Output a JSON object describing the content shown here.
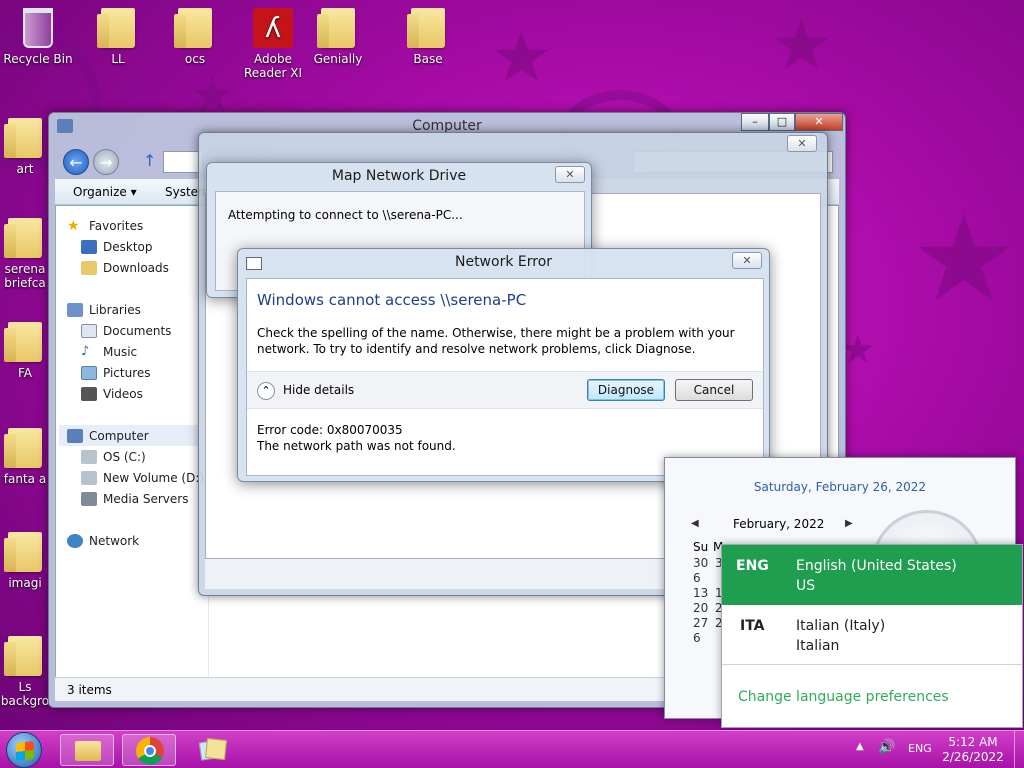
{
  "desktop_icons": [
    {
      "label": "Recycle Bin"
    },
    {
      "label": "LL"
    },
    {
      "label": "ocs"
    },
    {
      "label": "Adobe Reader XI"
    },
    {
      "label": "Genially"
    },
    {
      "label": "Base"
    },
    {
      "label": "art"
    },
    {
      "label": "serena briefca"
    },
    {
      "label": "FA"
    },
    {
      "label": "fanta a"
    },
    {
      "label": "imagi"
    },
    {
      "label": "Ls backgro"
    }
  ],
  "explorer": {
    "title": "Computer",
    "toolbar": {
      "organize": "Organize ▾",
      "system": "System"
    },
    "nav": {
      "favorites": "Favorites",
      "desktop": "Desktop",
      "downloads": "Downloads",
      "libraries": "Libraries",
      "documents": "Documents",
      "music": "Music",
      "pictures": "Pictures",
      "videos": "Videos",
      "computer": "Computer",
      "os_c": "OS (C:)",
      "new_volume": "New Volume (D:)",
      "media_servers": "Media Servers",
      "network": "Network"
    },
    "status": "3 items"
  },
  "map_drive": {
    "title": "Map Network Drive",
    "message": "Attempting to connect to \\\\serena-PC..."
  },
  "network_error": {
    "title": "Network Error",
    "heading": "Windows cannot access \\\\serena-PC",
    "body": "Check the spelling of the name. Otherwise, there might be a problem with your network. To try to identify and resolve network problems, click Diagnose.",
    "hide_details": "Hide details",
    "diagnose": "Diagnose",
    "cancel": "Cancel",
    "error_code": "Error code: 0x80070035",
    "error_detail": "The network path was not found."
  },
  "calendar": {
    "date_long": "Saturday, February 26, 2022",
    "month": "February, 2022",
    "weekday_headers": [
      "Su",
      "M"
    ],
    "col1": [
      "30",
      "6",
      "13",
      "20",
      "27",
      "6"
    ],
    "col2": [
      "3",
      "",
      "1",
      "2",
      "2",
      ""
    ]
  },
  "language_menu": {
    "items": [
      {
        "code": "ENG",
        "name": "English (United States)",
        "sub": "US"
      },
      {
        "code": "ITA",
        "name": "Italian (Italy)",
        "sub": "Italian"
      }
    ],
    "change": "Change language preferences"
  },
  "taskbar": {
    "lang": "ENG",
    "time": "5:12 AM",
    "date": "2/26/2022"
  },
  "colors": {
    "lang_selected": "#1e9e4e",
    "link_green": "#2fae56",
    "dialog_heading": "#1a3f8e"
  }
}
